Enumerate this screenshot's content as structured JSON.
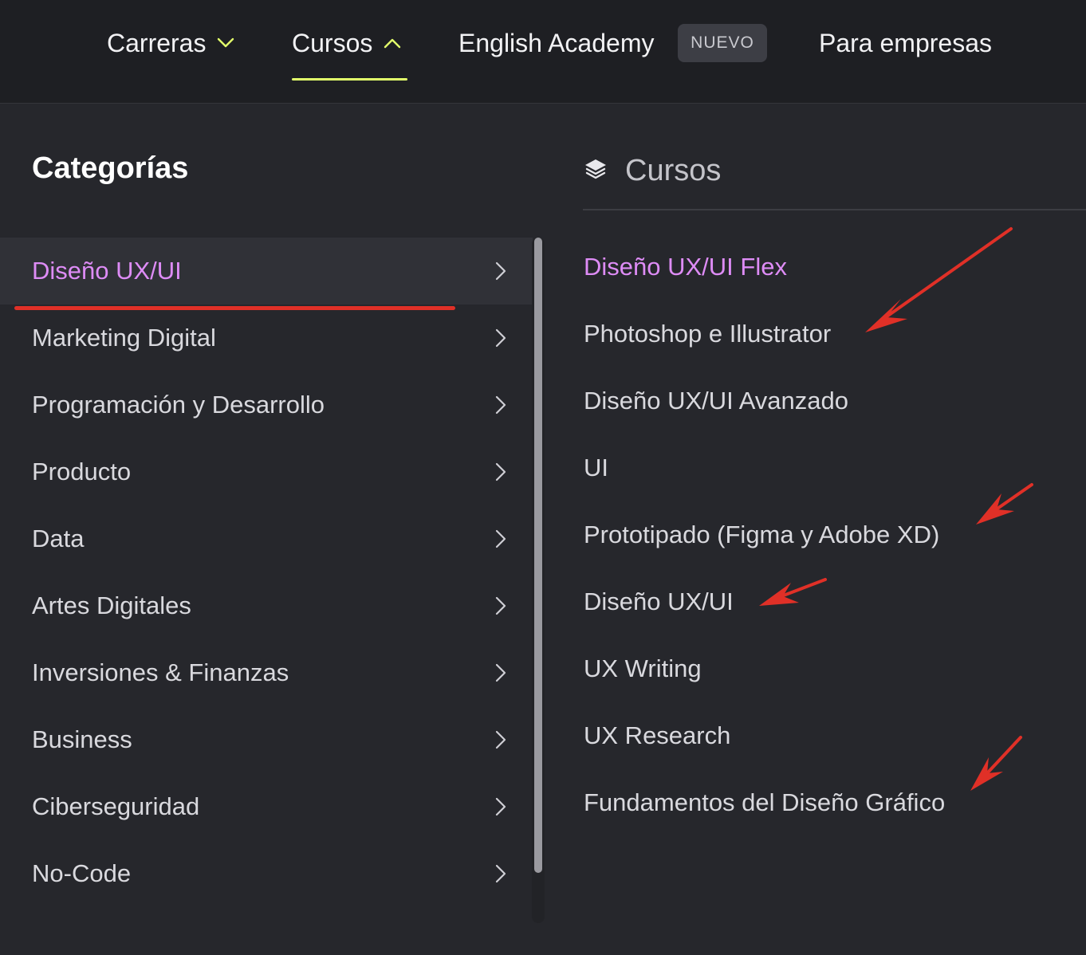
{
  "topnav": {
    "items": [
      {
        "label": "Carreras",
        "icon": "chevron-down-icon"
      },
      {
        "label": "Cursos",
        "icon": "chevron-up-icon"
      },
      {
        "label": "English Academy"
      },
      {
        "label": "Para empresas"
      }
    ],
    "badge": "NUEVO",
    "accent_color": "#e3ff6b"
  },
  "categories": {
    "title": "Categorías",
    "items": [
      {
        "label": "Diseño UX/UI"
      },
      {
        "label": "Marketing Digital"
      },
      {
        "label": "Programación y Desarrollo"
      },
      {
        "label": "Producto"
      },
      {
        "label": "Data"
      },
      {
        "label": "Artes Digitales"
      },
      {
        "label": "Inversiones & Finanzas"
      },
      {
        "label": "Business"
      },
      {
        "label": "Ciberseguridad"
      },
      {
        "label": "No-Code"
      }
    ]
  },
  "courses": {
    "title": "Cursos",
    "icon": "layers-icon",
    "items": [
      {
        "label": "Diseño UX/UI Flex"
      },
      {
        "label": "Photoshop e Illustrator"
      },
      {
        "label": "Diseño UX/UI Avanzado"
      },
      {
        "label": "UI"
      },
      {
        "label": "Prototipado (Figma y Adobe XD)"
      },
      {
        "label": "Diseño UX/UI"
      },
      {
        "label": "UX Writing"
      },
      {
        "label": "UX Research"
      },
      {
        "label": "Fundamentos del Diseño Gráfico"
      }
    ]
  },
  "colors": {
    "active_purple": "#de8cf6",
    "annotation_red": "#e03027"
  }
}
